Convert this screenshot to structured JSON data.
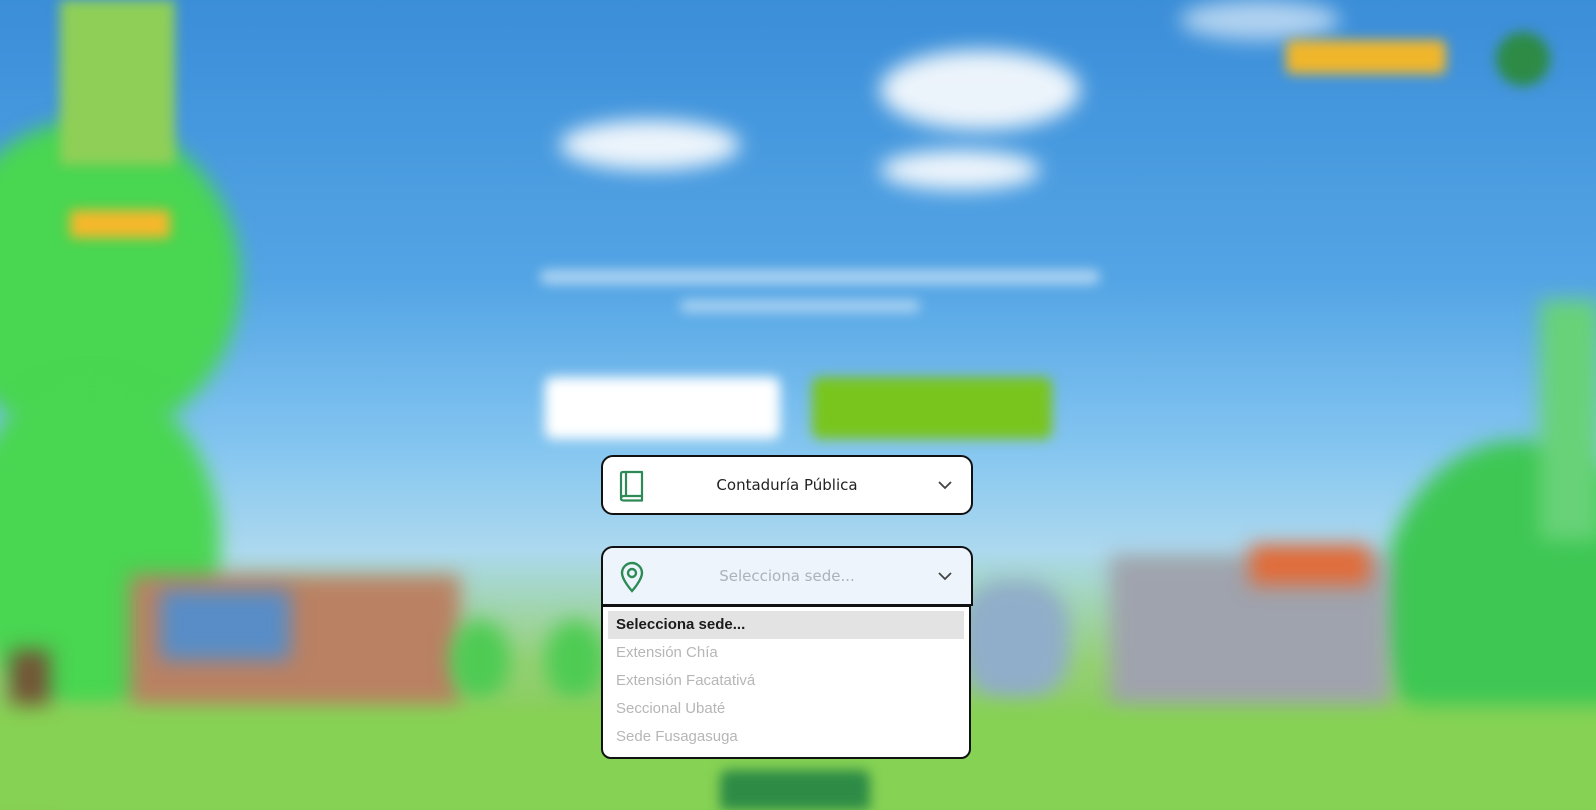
{
  "program_select": {
    "icon": "book-icon",
    "value": "Contaduría Pública"
  },
  "campus_select": {
    "icon": "location-pin-icon",
    "placeholder": "Selecciona sede...",
    "options": [
      "Selecciona sede...",
      "Extensión Chía",
      "Extensión Facatativá",
      "Seccional Ubaté",
      "Sede Fusagasuga"
    ],
    "selected_index": 0
  },
  "colors": {
    "icon_green": "#2e8b57",
    "border": "#111111",
    "accent_green": "#79c51e",
    "accent_yellow": "#f0b62b"
  }
}
